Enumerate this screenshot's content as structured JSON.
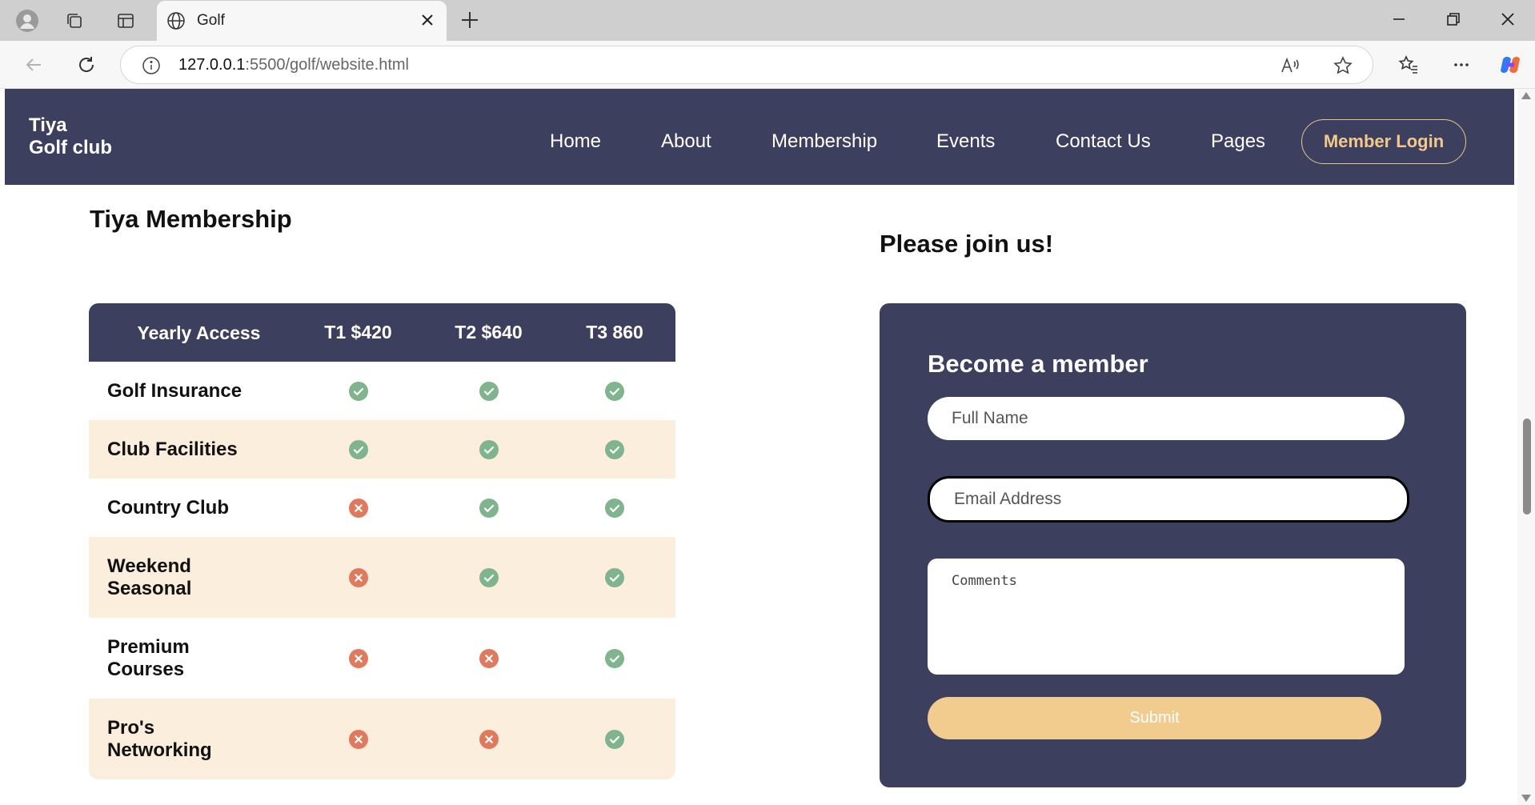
{
  "browser": {
    "tab_title": "Golf",
    "url_host": "127.0.0.1",
    "url_rest": ":5500/golf/website.html"
  },
  "nav": {
    "brand_line1": "Tiya",
    "brand_line2": "Golf club",
    "links": [
      "Home",
      "About",
      "Membership",
      "Events",
      "Contact Us",
      "Pages"
    ],
    "login": "Member Login"
  },
  "membership": {
    "title": "Tiya Membership",
    "headers": [
      "Yearly Access",
      "T1 $420",
      "T2 $640",
      "T3 860"
    ],
    "rows": [
      {
        "feature": "Golf Insurance",
        "t1": true,
        "t2": true,
        "t3": true
      },
      {
        "feature": "Club Facilities",
        "t1": true,
        "t2": true,
        "t3": true
      },
      {
        "feature": "Country Club",
        "t1": false,
        "t2": true,
        "t3": true
      },
      {
        "feature": "Weekend Seasonal",
        "t1": false,
        "t2": true,
        "t3": true
      },
      {
        "feature": "Premium Courses",
        "t1": false,
        "t2": false,
        "t3": true
      },
      {
        "feature": "Pro's Networking",
        "t1": false,
        "t2": false,
        "t3": true
      }
    ]
  },
  "join": {
    "title": "Please join us!",
    "form_title": "Become a member",
    "name_placeholder": "Full Name",
    "email_placeholder": "Email Address",
    "comments_placeholder": "Comments",
    "submit": "Submit"
  },
  "colors": {
    "navy": "#3c3f5e",
    "cream": "#fbeedd",
    "gold": "#f2cc8f",
    "check": "#7fb48e",
    "cross": "#e07a5f"
  }
}
